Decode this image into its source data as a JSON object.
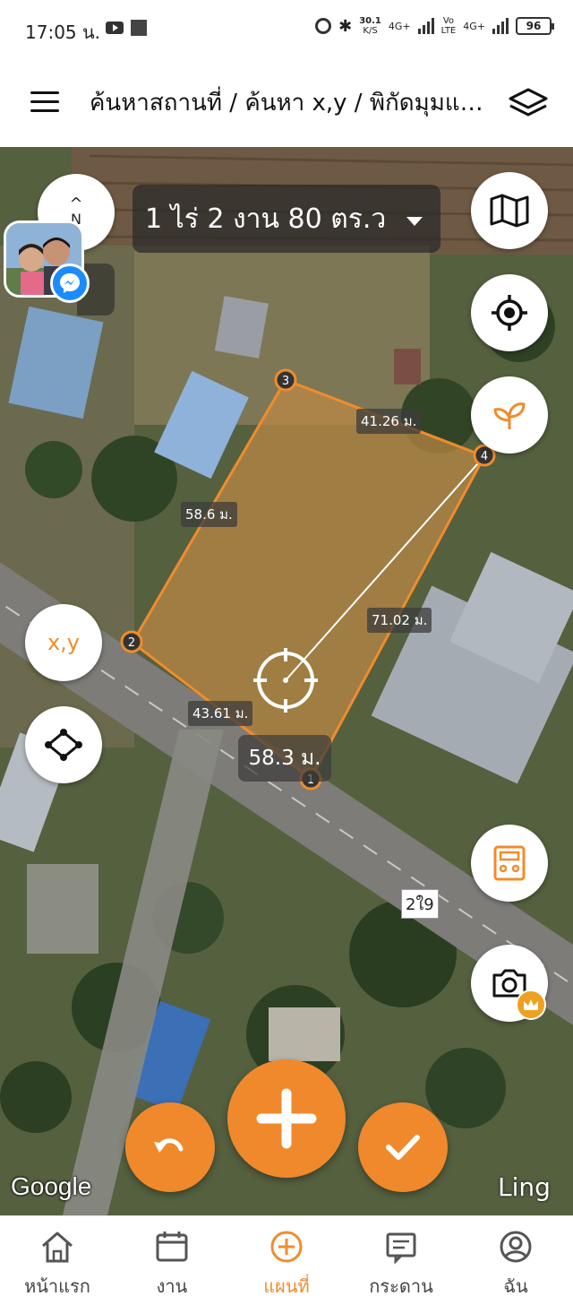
{
  "status": {
    "time": "17:05 น.",
    "net_speed_value": "30.1",
    "net_speed_unit": "K/S",
    "net1": "4G+",
    "net2_top": "Vo",
    "net2_bottom": "LTE",
    "net3": "4G+",
    "battery": "96"
  },
  "header": {
    "title": "ค้นหาสถานที่ / ค้นหา x,y / พิกัดมุมแปลง",
    "menu_icon": "hamburger-menu-icon",
    "layers_icon": "layers-icon"
  },
  "map": {
    "area_label": "1 ไร่ 2 งาน 80 ตร.ว",
    "compass_label": "N",
    "avatar_badge": "ํ",
    "measurements": {
      "side_3_4": "41.26 ม.",
      "side_2_3": "58.6 ม.",
      "diagonal": "71.02 ม.",
      "side_1_2": "43.61 ม.",
      "side_1_4": "58.3 ม."
    },
    "vertices": [
      "1",
      "2",
      "3",
      "4"
    ],
    "road_label": "2ใ9",
    "xy_button": "x,y",
    "google_logo": "Google",
    "watermark": "Ling",
    "accent_color": "#f08c2c"
  },
  "nav": {
    "items": [
      {
        "label": "หน้าแรก",
        "icon": "home-icon"
      },
      {
        "label": "งาน",
        "icon": "calendar-icon"
      },
      {
        "label": "แผนที่",
        "icon": "plus-circle-icon",
        "active": true
      },
      {
        "label": "กระดาน",
        "icon": "board-icon"
      },
      {
        "label": "ฉัน",
        "icon": "profile-icon"
      }
    ]
  }
}
